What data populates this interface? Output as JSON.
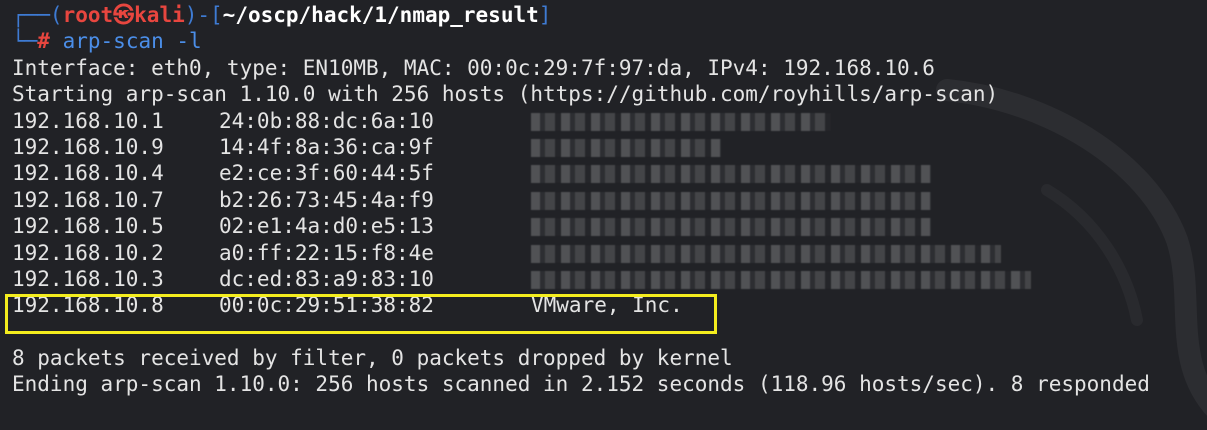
{
  "prompt": {
    "frame_top_left": "┌──(",
    "user": "root",
    "separator_symbol": "㉿",
    "host": "kali",
    "frame_mid": ")-[",
    "path": "~/oscp/hack/1/nmap_result",
    "frame_close": "]",
    "frame_bottom_left": "└─",
    "hash": "#",
    "command": "arp-scan -l"
  },
  "output": {
    "interface_line": "Interface: eth0, type: EN10MB, MAC: 00:0c:29:7f:97:da, IPv4: 192.168.10.6",
    "start_line": "Starting arp-scan 1.10.0 with 256 hosts (https://github.com/royhills/arp-scan)",
    "hosts": [
      {
        "ip": "192.168.10.1",
        "mac": "24:0b:88:dc:6a:10",
        "vendor": ""
      },
      {
        "ip": "192.168.10.9",
        "mac": "14:4f:8a:36:ca:9f",
        "vendor": ""
      },
      {
        "ip": "192.168.10.4",
        "mac": "e2:ce:3f:60:44:5f",
        "vendor": ""
      },
      {
        "ip": "192.168.10.7",
        "mac": "b2:26:73:45:4a:f9",
        "vendor": ""
      },
      {
        "ip": "192.168.10.5",
        "mac": "02:e1:4a:d0:e5:13",
        "vendor": ""
      },
      {
        "ip": "192.168.10.2",
        "mac": "a0:ff:22:15:f8:4e",
        "vendor": ""
      },
      {
        "ip": "192.168.10.3",
        "mac": "dc:ed:83:a9:83:10",
        "vendor": ""
      },
      {
        "ip": "192.168.10.8",
        "mac": "00:0c:29:51:38:82",
        "vendor": "VMware, Inc."
      }
    ],
    "packets_line": "8 packets received by filter, 0 packets dropped by kernel",
    "ending_line": "Ending arp-scan 1.10.0: 256 hosts scanned in 2.152 seconds (118.96 hosts/sec). 8 responded"
  },
  "colors": {
    "background": "#212226",
    "frame": "#3e7bd3",
    "user_host": "#e8463f",
    "command": "#4b8ee8",
    "highlight": "#f4ed1e"
  }
}
